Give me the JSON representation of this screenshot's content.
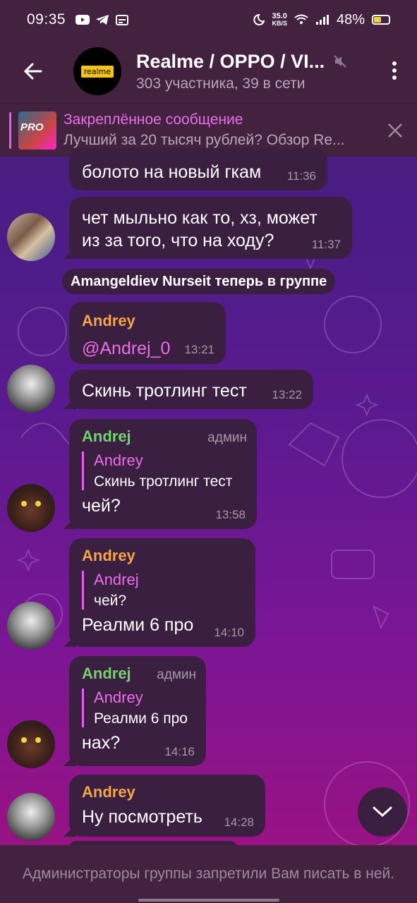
{
  "status_bar": {
    "time": "09:35",
    "speed_value": "35.0",
    "speed_unit": "KB/S",
    "battery": "48%",
    "battery_level": 0.48
  },
  "header": {
    "title": "Realme / OPPO / VI...",
    "subtitle": "303 участника, 39 в сети",
    "avatar_logo": "realme"
  },
  "pinned": {
    "title": "Закреплённое сообщение",
    "message": "Лучший за 20 тысяч рублей? Обзор Re...",
    "thumb_text": "PRO"
  },
  "messages": [
    {
      "text": "болото на новый гкам",
      "time": "11:36"
    },
    {
      "text": "чет мыльно как то, хз, может из за того, что на ходу?",
      "time": "11:37"
    },
    {
      "service": "Amangeldiev Nurseit теперь в группе"
    },
    {
      "sender": "Andrey",
      "text": "@Andrej_0",
      "time": "13:21"
    },
    {
      "text": "Скинь тротлинг тест",
      "time": "13:22"
    },
    {
      "sender": "Andrej",
      "badge": "админ",
      "reply_name": "Andrey",
      "reply_text": "Скинь тротлинг тест",
      "text": "чей?",
      "time": "13:58"
    },
    {
      "sender": "Andrey",
      "reply_name": "Andrej",
      "reply_text": "чей?",
      "text": "Реалми 6 про",
      "time": "14:10"
    },
    {
      "sender": "Andrej",
      "badge": "админ",
      "reply_name": "Andrey",
      "reply_text": "Реалми 6 про",
      "text": "нах?",
      "time": "14:16"
    },
    {
      "sender": "Andrey",
      "text": "Ну посмотреть",
      "time": "14:28"
    }
  ],
  "bottom": {
    "notice": "Администраторы группы запретили Вам писать в ней."
  },
  "colors": {
    "bar_bg": "#43223f",
    "bubble_bg": "#3a1f40",
    "accent_pink": "#e95ee8",
    "sender_orange": "#f4a545",
    "sender_green": "#6fd46a"
  },
  "icons": [
    "back-arrow-icon",
    "mute-icon",
    "more-vert-icon",
    "close-icon",
    "chevron-down-icon"
  ]
}
